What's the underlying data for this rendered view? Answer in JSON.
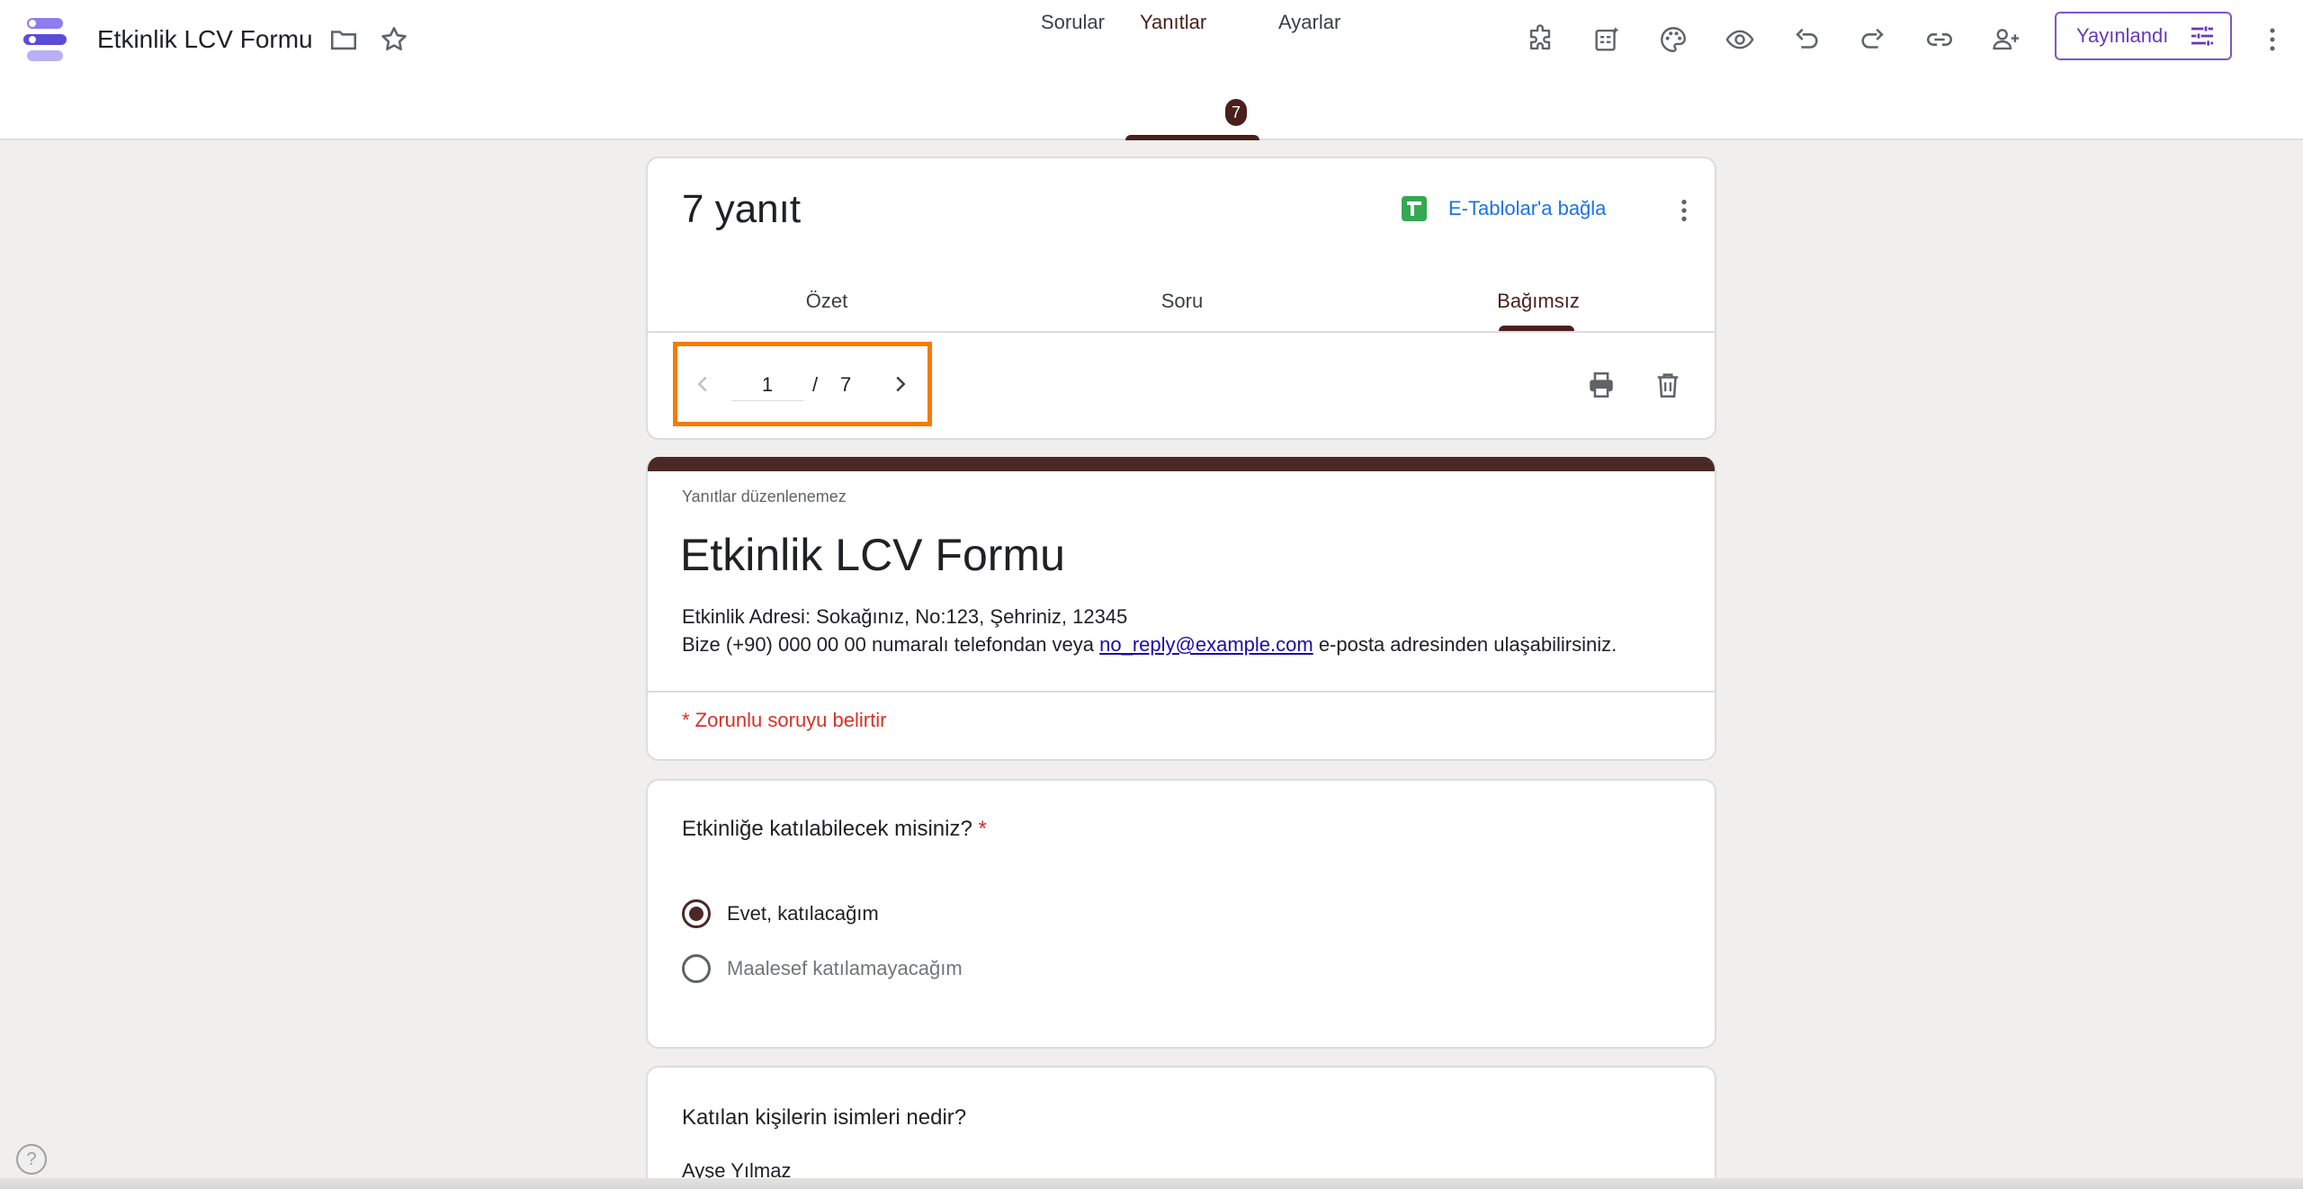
{
  "app": {
    "title": "Etkinlik LCV Formu",
    "publish_label": "Yayınlandı"
  },
  "tabs": [
    {
      "label": "Sorular"
    },
    {
      "label": "Yanıtlar"
    },
    {
      "label": "Ayarlar"
    }
  ],
  "responses_badge": "7",
  "responses": {
    "count_label": "7 yanıt",
    "sheets_link": "E-Tablolar'a bağla",
    "subtabs": [
      {
        "label": "Özet"
      },
      {
        "label": "Soru"
      },
      {
        "label": "Bağımsız"
      }
    ],
    "pager": {
      "current": "1",
      "separator": "/",
      "total": "7"
    }
  },
  "form": {
    "not_editable": "Yanıtlar düzenlenemez",
    "title": "Etkinlik LCV Formu",
    "desc_line1": "Etkinlik Adresi: Sokağınız, No:123, Şehriniz, 12345",
    "desc_line2_pre": "Bize (+90) 000 00 00 numaralı telefondan veya ",
    "desc_email": "no_reply@example.com",
    "desc_line2_post": " e-posta adresinden ulaşabilirsiniz.",
    "required_note": "* Zorunlu soruyu belirtir"
  },
  "questions": [
    {
      "title": "Etkinliğe katılabilecek misiniz?",
      "required_mark": "*",
      "options": [
        {
          "label": "Evet, katılacağım",
          "selected": true
        },
        {
          "label": "Maalesef katılamayacağım",
          "selected": false
        }
      ]
    },
    {
      "title": "Katılan kişilerin isimleri nedir?",
      "answer": "Ayşe Yılmaz"
    }
  ],
  "help_label": "?",
  "colors": {
    "accent": "#4a1f1c",
    "publish": "#673ab7",
    "link": "#1a73e8",
    "highlight_box": "#f57c00",
    "required": "#d93025"
  }
}
